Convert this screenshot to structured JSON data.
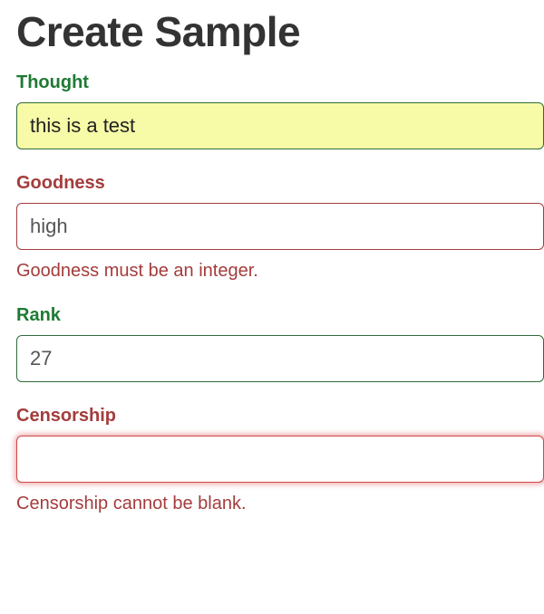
{
  "page": {
    "title": "Create Sample"
  },
  "fields": {
    "thought": {
      "label": "Thought",
      "value": "this is a test",
      "valid": true
    },
    "goodness": {
      "label": "Goodness",
      "value": "high",
      "valid": false,
      "error": "Goodness must be an integer."
    },
    "rank": {
      "label": "Rank",
      "value": "27",
      "valid": true
    },
    "censorship": {
      "label": "Censorship",
      "value": "",
      "valid": false,
      "error": "Censorship cannot be blank."
    }
  },
  "colors": {
    "valid": "#1f7a34",
    "error": "#a43c3c",
    "highlight_bg": "#f7faa7"
  }
}
